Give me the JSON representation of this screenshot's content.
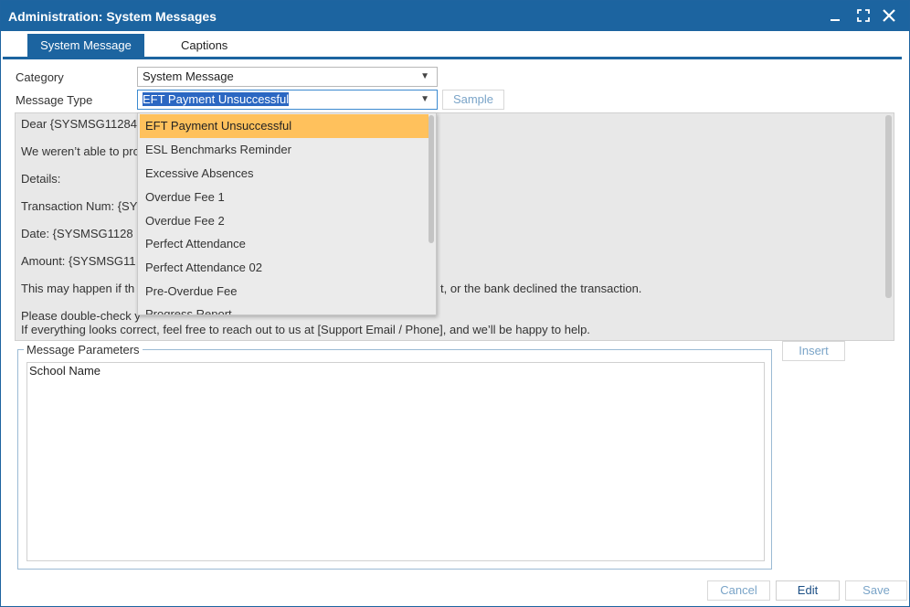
{
  "window": {
    "title": "Administration: System Messages",
    "accent_color": "#1c64a0",
    "controls": [
      "minimize-icon",
      "maximize-icon",
      "close-icon"
    ]
  },
  "tabs": [
    {
      "label": "System Message",
      "active": true
    },
    {
      "label": "Captions",
      "active": false
    }
  ],
  "form": {
    "category_label": "Category",
    "category_value": "System Message",
    "message_type_label": "Message Type",
    "message_type_value": "EFT Payment Unsuccessful",
    "sample_button": "Sample"
  },
  "message_body": {
    "lines": [
      "Dear {SYSMSG11284",
      "We weren’t able to pro",
      "Details:",
      "Transaction Num: {SY",
      "Date:  {SYSMSG1128",
      "Amount: {SYSMSG11",
      "This may happen if th",
      "t, or the bank declined the transaction.",
      "Please double-check y",
      "If everything looks correct, feel free to reach out to us at [Support Email / Phone], and we’ll be happy to help."
    ]
  },
  "dropdown": {
    "options": [
      "EFT Payment Unsuccessful",
      "ESL Benchmarks Reminder",
      "Excessive Absences",
      "Overdue Fee 1",
      "Overdue Fee 2",
      "Perfect Attendance",
      "Perfect Attendance 02",
      "Pre-Overdue Fee",
      "Progress Report"
    ],
    "selected_index": 0,
    "highlight_color": "#ffc15c"
  },
  "parameters": {
    "legend": "Message Parameters",
    "items": [
      "School Name"
    ],
    "insert_button": "Insert"
  },
  "footer": {
    "cancel": "Cancel",
    "edit": "Edit",
    "save": "Save"
  }
}
